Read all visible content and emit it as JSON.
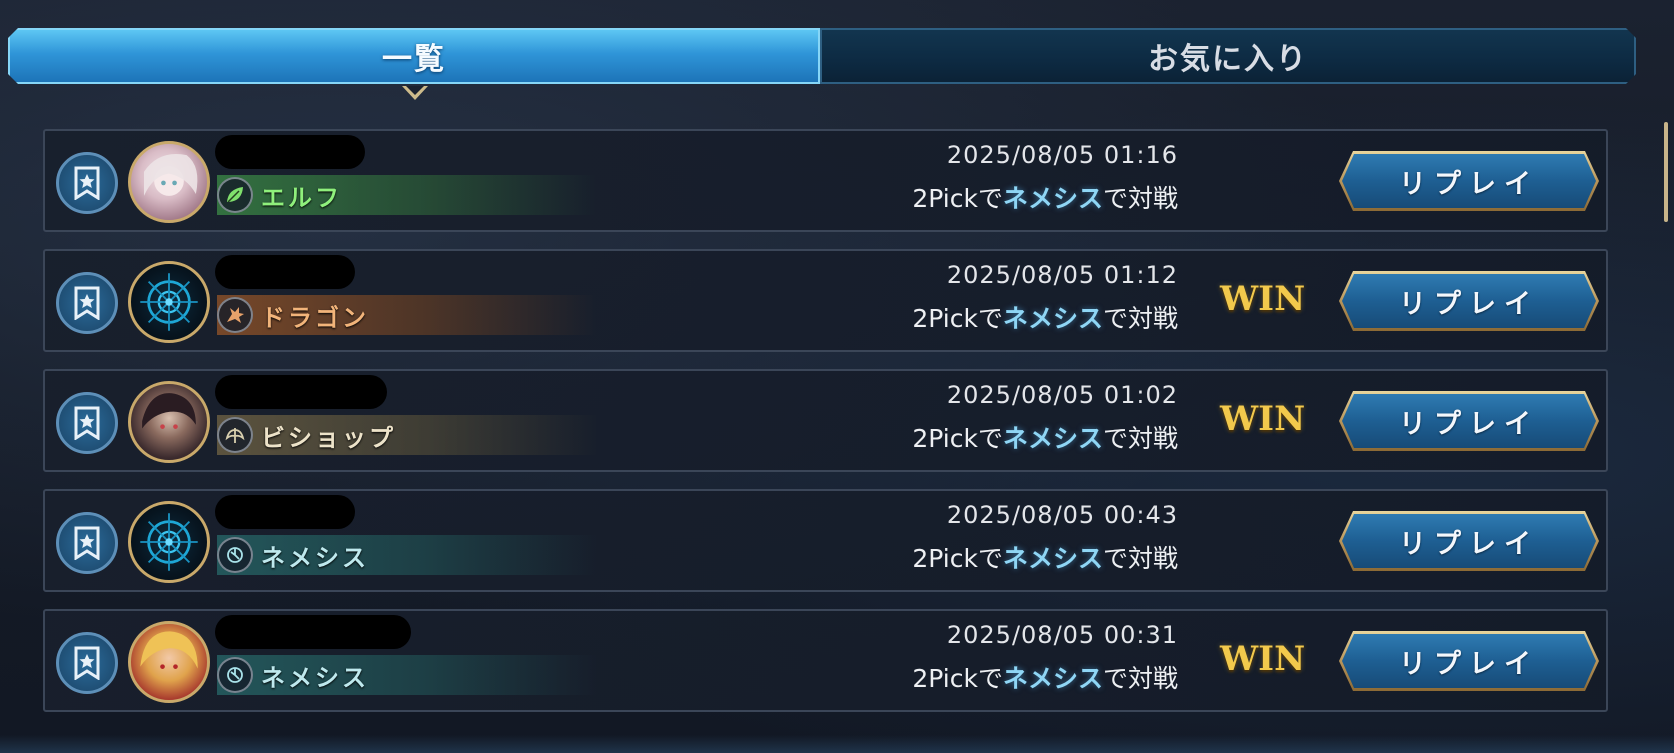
{
  "tabs": [
    {
      "label": "一覧",
      "active": true
    },
    {
      "label": "お気に入り",
      "active": false
    }
  ],
  "colors": {
    "win": "#f2c94c",
    "highlight": "#8fd6f5",
    "tab_active": "#2f95d8",
    "button_frame": "#c9a96a"
  },
  "replays": [
    {
      "favorite_icon": "bookmark-star-icon",
      "avatar_icon": "player-portrait",
      "class_icon": "leaf-icon",
      "class_name": "エルフ",
      "date": "2025/08/05 01:16",
      "mode": "2Pick",
      "particle1": "で",
      "deck_class": "ネメシス",
      "particle2": "で対戦",
      "result": "",
      "replay_label": "リプレイ"
    },
    {
      "favorite_icon": "bookmark-star-icon",
      "avatar_icon": "emblem-portrait",
      "class_icon": "dragon-icon",
      "class_name": "ドラゴン",
      "date": "2025/08/05 01:12",
      "mode": "2Pick",
      "particle1": "で",
      "deck_class": "ネメシス",
      "particle2": "で対戦",
      "result": "WIN",
      "replay_label": "リプレイ"
    },
    {
      "favorite_icon": "bookmark-star-icon",
      "avatar_icon": "player-portrait",
      "class_icon": "wings-icon",
      "class_name": "ビショップ",
      "date": "2025/08/05 01:02",
      "mode": "2Pick",
      "particle1": "で",
      "deck_class": "ネメシス",
      "particle2": "で対戦",
      "result": "WIN",
      "replay_label": "リプレイ"
    },
    {
      "favorite_icon": "bookmark-star-icon",
      "avatar_icon": "emblem-portrait",
      "class_icon": "gear-spiral-icon",
      "class_name": "ネメシス",
      "date": "2025/08/05 00:43",
      "mode": "2Pick",
      "particle1": "で",
      "deck_class": "ネメシス",
      "particle2": "で対戦",
      "result": "",
      "replay_label": "リプレイ"
    },
    {
      "favorite_icon": "bookmark-star-icon",
      "avatar_icon": "player-portrait",
      "class_icon": "gear-spiral-icon",
      "class_name": "ネメシス",
      "date": "2025/08/05 00:31",
      "mode": "2Pick",
      "particle1": "で",
      "deck_class": "ネメシス",
      "particle2": "で対戦",
      "result": "WIN",
      "replay_label": "リプレイ"
    }
  ]
}
